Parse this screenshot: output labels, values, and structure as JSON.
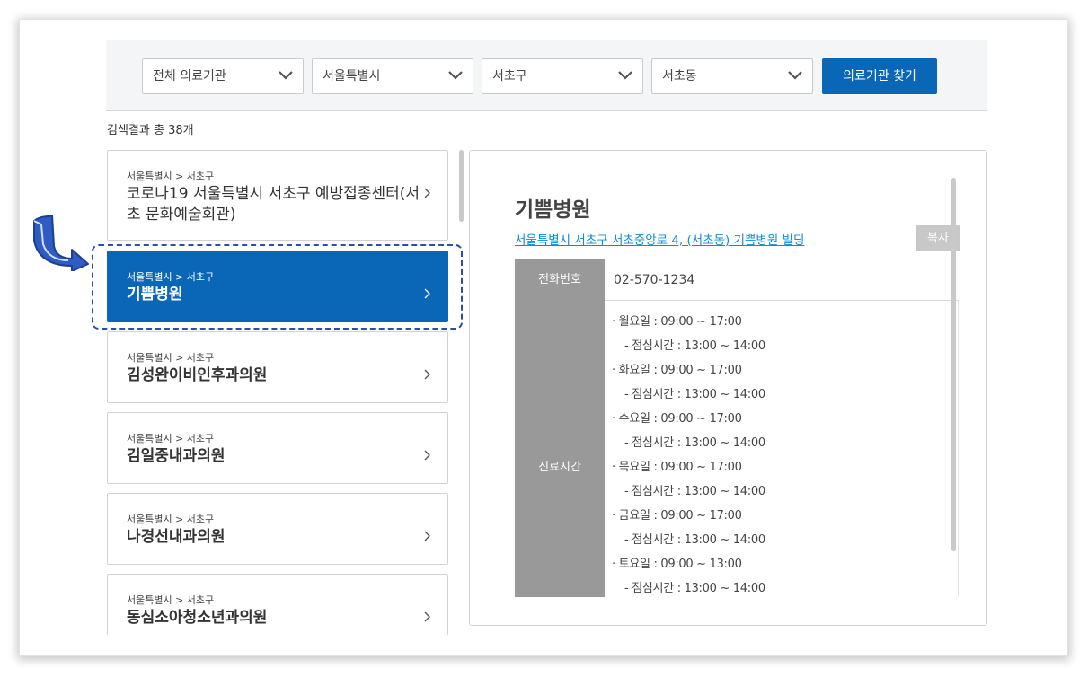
{
  "filters": {
    "type": "전체 의료기관",
    "city": "서울특별시",
    "district": "서초구",
    "dong": "서초동",
    "search_label": "의료기관 찾기"
  },
  "result_count": "검색결과 총 38개",
  "list": [
    {
      "path": "서울특별시 > 서초구",
      "name": "코로나19 서울특별시 서초구 예방접종센터(서초 문화예술회관)"
    },
    {
      "path": "서울특별시 > 서초구",
      "name": "기쁨병원"
    },
    {
      "path": "서울특별시 > 서초구",
      "name": "김성완이비인후과의원"
    },
    {
      "path": "서울특별시 > 서초구",
      "name": "김일중내과의원"
    },
    {
      "path": "서울특별시 > 서초구",
      "name": "나경선내과의원"
    },
    {
      "path": "서울특별시 > 서초구",
      "name": "동심소아청소년과의원"
    }
  ],
  "detail": {
    "title": "기쁨병원",
    "address": "서울특별시 서초구 서초중앙로 4, (서초동) 기쁨병원 빌딩",
    "copy_label": "복사",
    "phone_label": "전화번호",
    "phone": "02-570-1234",
    "hours_label": "진료시간",
    "hours": [
      "· 월요일 : 09:00 ~ 17:00",
      "- 점심시간 : 13:00 ~ 14:00",
      "· 화요일 : 09:00 ~ 17:00",
      "- 점심시간 : 13:00 ~ 14:00",
      "· 수요일 : 09:00 ~ 17:00",
      "- 점심시간 : 13:00 ~ 14:00",
      "· 목요일 : 09:00 ~ 17:00",
      "- 점심시간 : 13:00 ~ 14:00",
      "· 금요일 : 09:00 ~ 17:00",
      "- 점심시간 : 13:00 ~ 14:00",
      "· 토요일 : 09:00 ~ 13:00",
      "- 점심시간 : 13:00 ~ 14:00"
    ]
  },
  "colors": {
    "primary": "#0a67b7",
    "link": "#0a8dd6",
    "table_header": "#999999",
    "annotation": "#2a4fa6"
  },
  "icons": [
    "chevron-down-icon",
    "chevron-right-icon",
    "pointer-arrow-icon"
  ]
}
